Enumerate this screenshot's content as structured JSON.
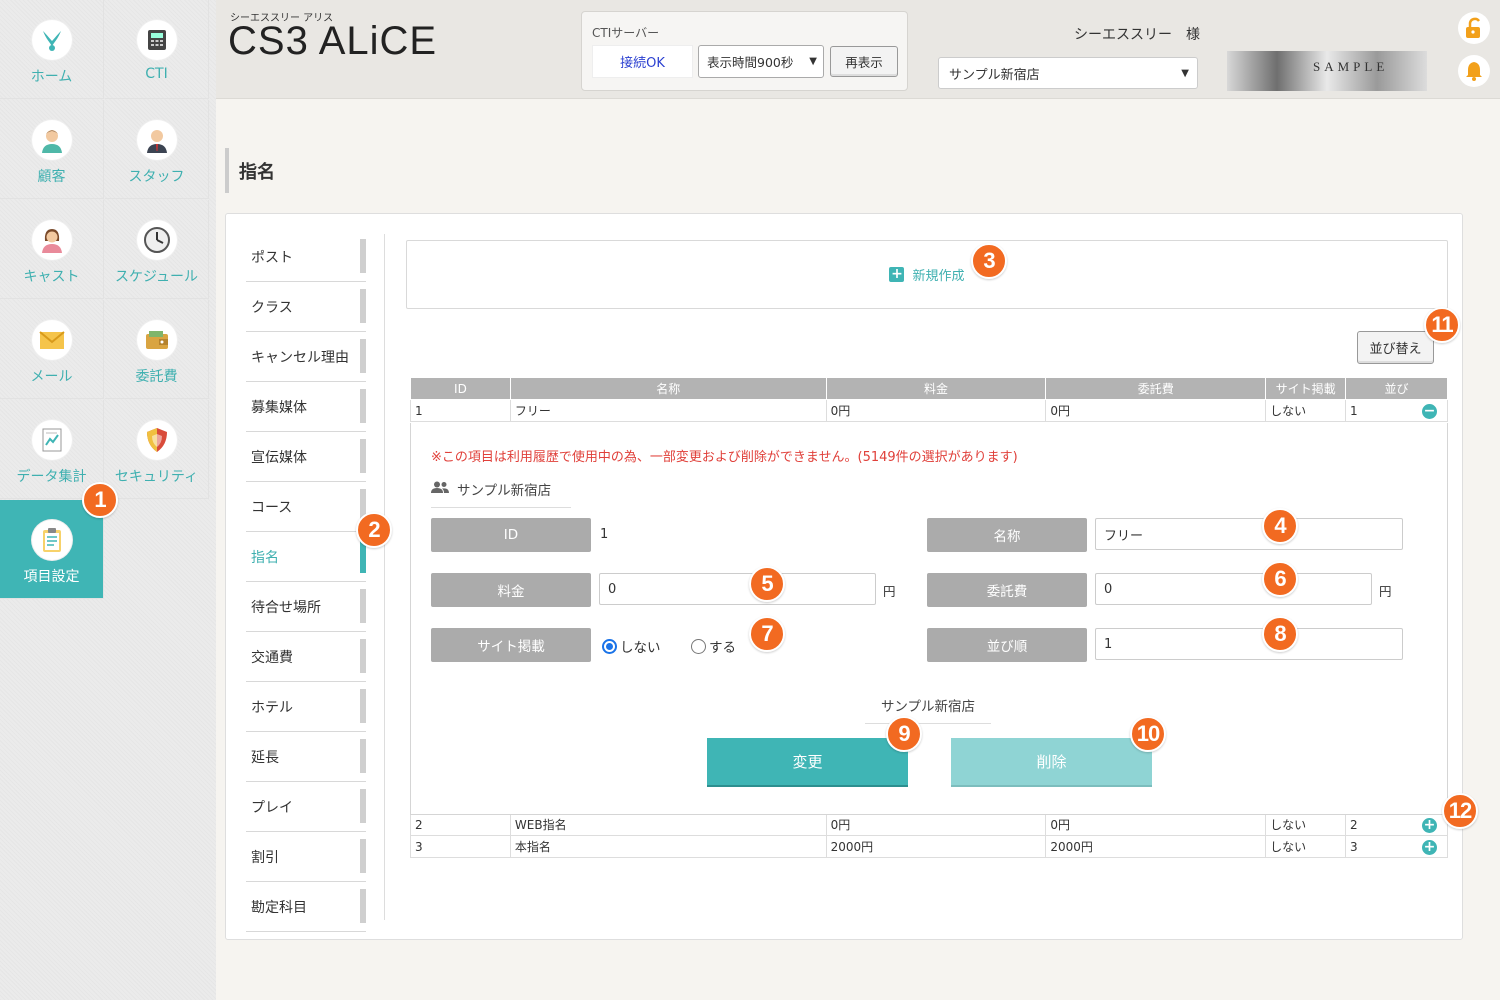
{
  "nav": {
    "items": [
      {
        "label": "ホーム",
        "icon": "rabbit-logo-icon"
      },
      {
        "label": "CTI",
        "icon": "phone-icon"
      },
      {
        "label": "顧客",
        "icon": "customer-icon"
      },
      {
        "label": "スタッフ",
        "icon": "staff-icon"
      },
      {
        "label": "キャスト",
        "icon": "cast-icon"
      },
      {
        "label": "スケジュール",
        "icon": "clock-icon"
      },
      {
        "label": "メール",
        "icon": "mail-icon"
      },
      {
        "label": "委託費",
        "icon": "wallet-icon"
      },
      {
        "label": "データ集計",
        "icon": "report-icon"
      },
      {
        "label": "セキュリティ",
        "icon": "shield-icon"
      },
      {
        "label": "項目設定",
        "icon": "clipboard-icon",
        "active": true
      }
    ]
  },
  "header": {
    "brand_sub": "シーエススリー アリス",
    "brand": "CS3 ALiCE",
    "cti_title": "CTIサーバー",
    "cti_status": "接続OK",
    "display_time": "表示時間900秒",
    "refresh_label": "再表示",
    "user": "シーエススリー　様",
    "shop": "サンプル新宿店",
    "logo_text": "SAMPLE"
  },
  "page": {
    "title": "指名"
  },
  "submenu": [
    "ポスト",
    "クラス",
    "キャンセル理由",
    "募集媒体",
    "宣伝媒体",
    "コース",
    "指名",
    "待合せ場所",
    "交通費",
    "ホテル",
    "延長",
    "プレイ",
    "割引",
    "勘定科目"
  ],
  "submenu_active": "指名",
  "actions": {
    "new_label": "新規作成",
    "sort_label": "並び替え"
  },
  "table": {
    "headers": [
      "ID",
      "名称",
      "料金",
      "委託費",
      "サイト掲載",
      "並び"
    ],
    "rows": [
      {
        "id": "1",
        "name": "フリー",
        "fee": "0円",
        "commission": "0円",
        "site": "しない",
        "order": "1",
        "toggle": "−"
      },
      {
        "id": "2",
        "name": "WEB指名",
        "fee": "0円",
        "commission": "0円",
        "site": "しない",
        "order": "2",
        "toggle": "+"
      },
      {
        "id": "3",
        "name": "本指名",
        "fee": "2000円",
        "commission": "2000円",
        "site": "しない",
        "order": "3",
        "toggle": "+"
      }
    ]
  },
  "detail": {
    "warning": "※この項目は利用履歴で使用中の為、一部変更および削除ができません。(5149件の選択があります)",
    "shop": "サンプル新宿店",
    "labels": {
      "id": "ID",
      "name": "名称",
      "fee": "料金",
      "commission": "委託費",
      "site": "サイト掲載",
      "order": "並び順"
    },
    "values": {
      "id": "1",
      "name": "フリー",
      "fee": "0",
      "commission": "0",
      "order": "1"
    },
    "unit": "円",
    "radio_no": "しない",
    "radio_yes": "する",
    "site_selected": "しない",
    "update_label": "変更",
    "delete_label": "削除"
  },
  "badges": [
    "1",
    "2",
    "3",
    "4",
    "5",
    "6",
    "7",
    "8",
    "9",
    "10",
    "11",
    "12"
  ],
  "colors": {
    "accent": "#3fb5b5",
    "badge": "#f26a21",
    "warning": "#e0403a"
  }
}
